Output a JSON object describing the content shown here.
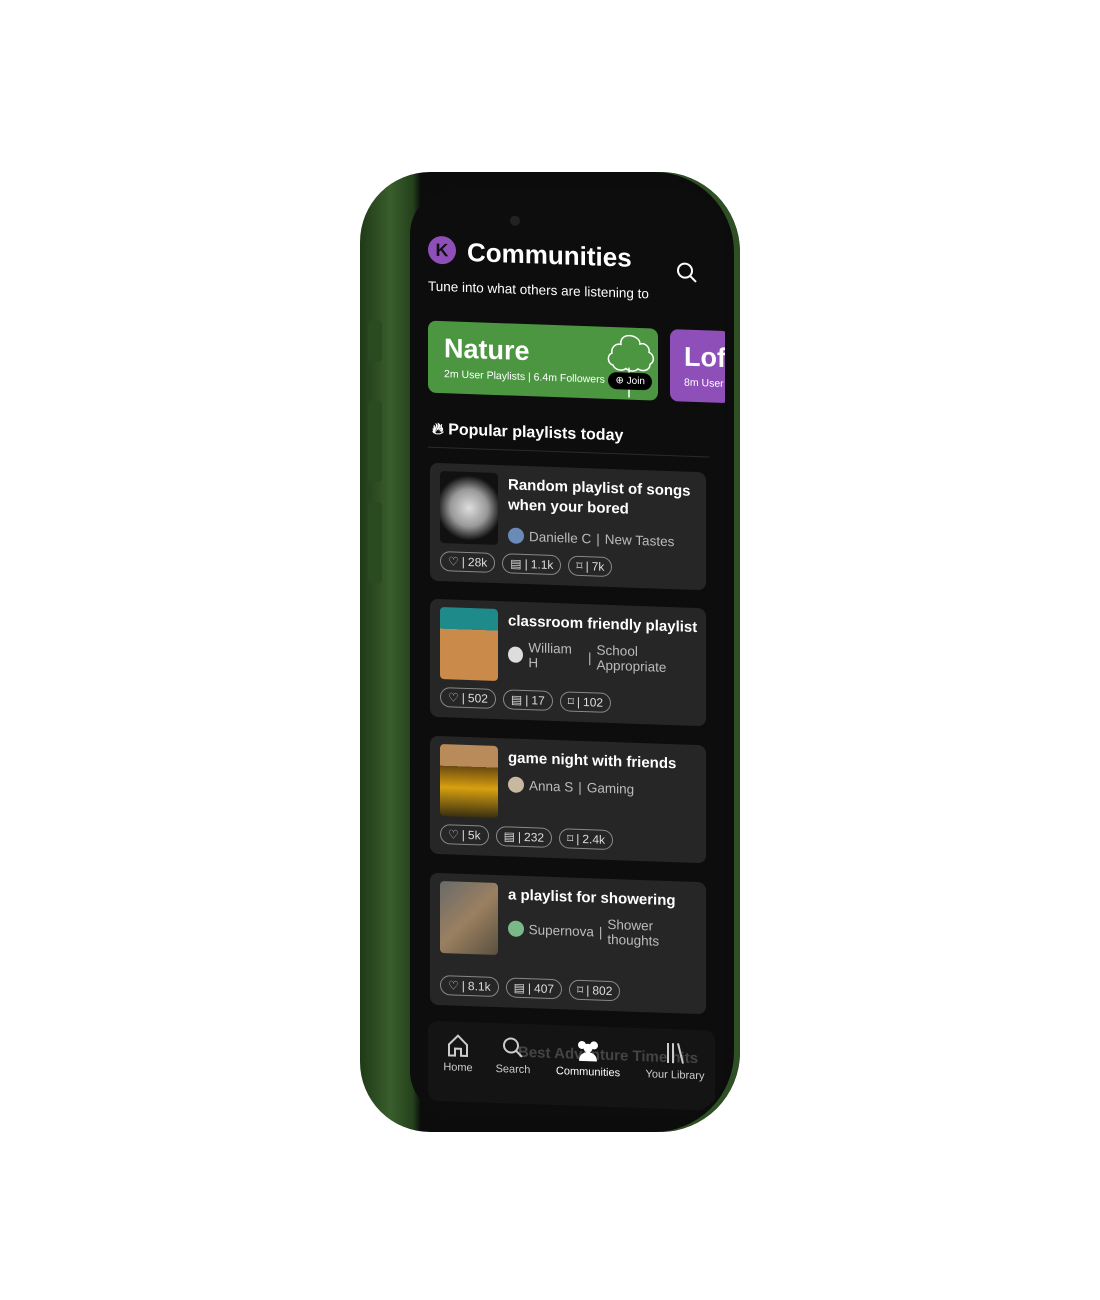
{
  "header": {
    "avatar_letter": "K",
    "title": "Communities",
    "subtitle": "Tune into what others are listening to",
    "search_icon": "search-icon"
  },
  "banners": [
    {
      "name": "Nature",
      "meta": "2m User Playlists | 6.4m Followers",
      "join_label": "Join",
      "color": "#4c9642"
    },
    {
      "name": "Lofi",
      "meta": "8m User",
      "color": "#8e4fb8"
    }
  ],
  "section_title": "Popular playlists today",
  "playlists": [
    {
      "title": "Random playlist of songs when your bored",
      "author": "Danielle C",
      "category": "New Tastes",
      "likes": "28k",
      "comments": "1.1k",
      "saves": "7k"
    },
    {
      "title": "classroom friendly playlist",
      "author": "William H",
      "category": "School Appropriate",
      "likes": "502",
      "comments": "17",
      "saves": "102"
    },
    {
      "title": "game night with friends",
      "author": "Anna S",
      "category": "Gaming",
      "likes": "5k",
      "comments": "232",
      "saves": "2.4k"
    },
    {
      "title": "a playlist for showering",
      "author": "Supernova",
      "category": "Shower thoughts",
      "likes": "8.1k",
      "comments": "407",
      "saves": "802"
    }
  ],
  "behind_nav_text": "Best Adventure Time hits",
  "nav": [
    {
      "label": "Home"
    },
    {
      "label": "Search"
    },
    {
      "label": "Communities",
      "active": true
    },
    {
      "label": "Your Library"
    }
  ]
}
